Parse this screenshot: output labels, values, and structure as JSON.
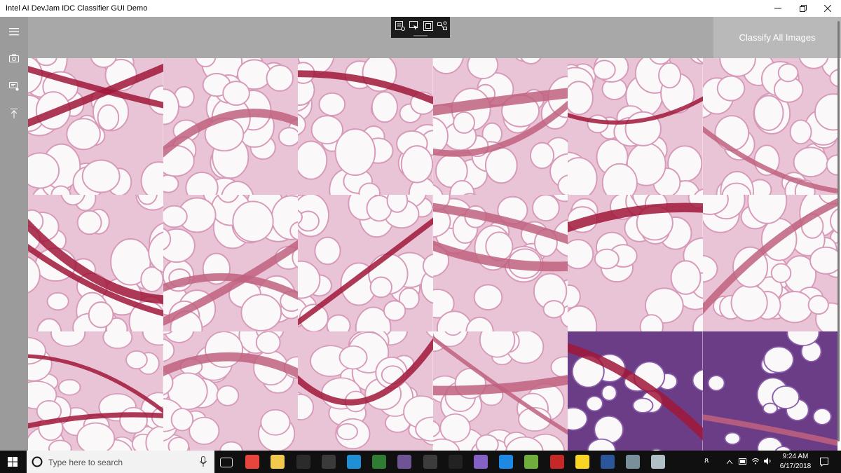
{
  "window": {
    "title": "Intel AI DevJam IDC Classifier GUI Demo",
    "controls": [
      "minimize-icon",
      "restore-icon",
      "close-icon"
    ]
  },
  "left_rail": {
    "items": [
      {
        "name": "hamburger-menu-icon"
      },
      {
        "name": "camera-icon"
      },
      {
        "name": "classify-icon"
      },
      {
        "name": "upload-icon"
      }
    ]
  },
  "command_bar": {
    "classify_label": "Classify All Images"
  },
  "debug_toolbar": {
    "icons": [
      "live-tree-icon",
      "select-element-icon",
      "display-layout-icon",
      "track-focus-icon"
    ]
  },
  "image_grid": {
    "columns": 6,
    "rows": 3,
    "tiles": [
      {
        "stain": "fatty"
      },
      {
        "stain": "fatty"
      },
      {
        "stain": "fatty"
      },
      {
        "stain": "fatty"
      },
      {
        "stain": "fatty"
      },
      {
        "stain": "fatty"
      },
      {
        "stain": "fatty"
      },
      {
        "stain": "fatty"
      },
      {
        "stain": "fatty"
      },
      {
        "stain": "fatty"
      },
      {
        "stain": "fatty"
      },
      {
        "stain": "fatty"
      },
      {
        "stain": "fatty"
      },
      {
        "stain": "fatty"
      },
      {
        "stain": "fatty"
      },
      {
        "stain": "fatty"
      },
      {
        "stain": "dense"
      },
      {
        "stain": "dense"
      }
    ]
  },
  "taskbar": {
    "search_placeholder": "Type here to search",
    "apps": [
      "task-view-icon",
      "chrome-icon",
      "file-explorer-icon",
      "cmd-icon",
      "terminal-icon",
      "azure-icon",
      "network-icon",
      "github-icon",
      "obs-icon",
      "davinci-icon",
      "visual-studio-icon",
      "vscode-icon",
      "notepad-plus-icon",
      "filezilla-icon",
      "app-icon",
      "word-icon",
      "app2-icon",
      "app3-icon"
    ],
    "clock": {
      "time": "9:24 AM",
      "date": "6/17/2018"
    }
  },
  "colors": {
    "rail": "#9b9b9b",
    "command_bar": "#a8a8a8",
    "stain_dark": "#a0173a",
    "stain_light": "#d79ab8",
    "dense_purple": "#6b3d86"
  }
}
